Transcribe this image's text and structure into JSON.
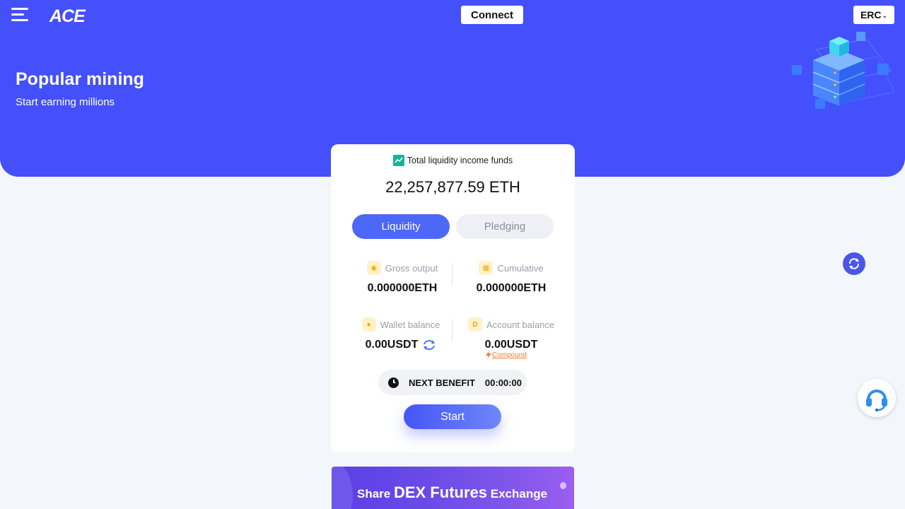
{
  "header": {
    "logo_text": "ACE",
    "connect_label": "Connect",
    "chain_label": "ERC"
  },
  "hero": {
    "title": "Popular mining",
    "subtitle": "Start earning millions"
  },
  "card": {
    "total_label": "Total liquidity income funds",
    "total_value": "22,257,877.59  ETH",
    "tabs": [
      {
        "label": "Liquidity",
        "active": true
      },
      {
        "label": "Pledging",
        "active": false
      }
    ],
    "stats": {
      "gross_output": {
        "label": "Gross output",
        "value": "0.000000ETH"
      },
      "cumulative": {
        "label": "Cumulative",
        "value": "0.000000ETH"
      },
      "wallet_balance": {
        "label": "Wallet balance",
        "value": "0.00USDT"
      },
      "account_balance": {
        "label": "Account balance",
        "value": "0.00USDT"
      }
    },
    "compound_label": "Compound",
    "next_benefit_label": "NEXT BENEFIT",
    "next_benefit_timer": "00:00:00",
    "start_label": "Start"
  },
  "banner": {
    "prefix": "Share",
    "highlight": "DEX Futures",
    "suffix": "Exchange"
  },
  "colors": {
    "primary": "#4350fb",
    "tab_active": "#4d67f6",
    "compound": "#f27b2b",
    "icon_green": "#1ab394"
  }
}
